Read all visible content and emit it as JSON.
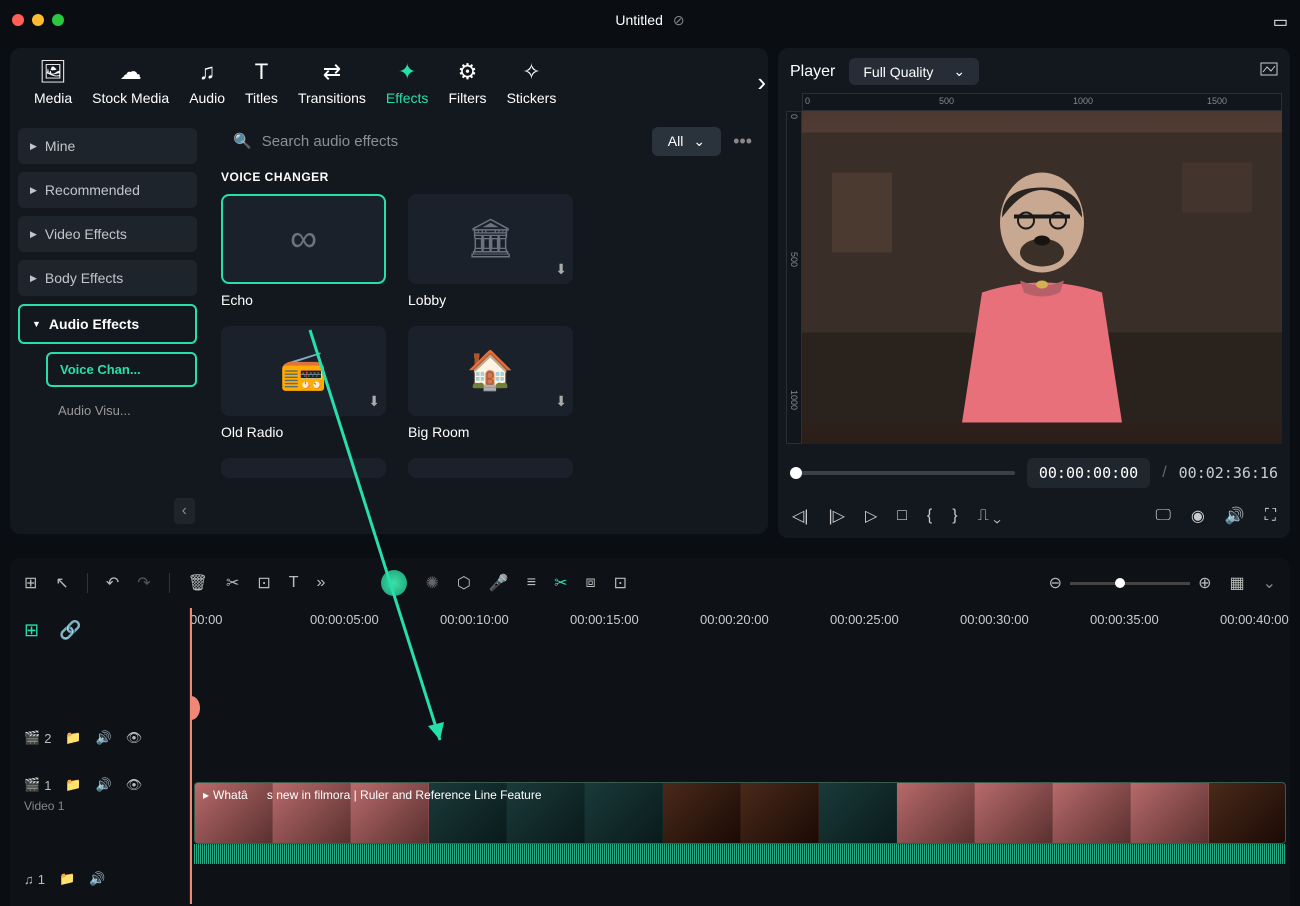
{
  "title": "Untitled",
  "tabs": {
    "media": "Media",
    "stock": "Stock Media",
    "audio": "Audio",
    "titles": "Titles",
    "transitions": "Transitions",
    "effects": "Effects",
    "filters": "Filters",
    "stickers": "Stickers"
  },
  "sidebar": {
    "mine": "Mine",
    "recommended": "Recommended",
    "video": "Video Effects",
    "body": "Body Effects",
    "audio": "Audio Effects",
    "voice": "Voice Chan...",
    "visu": "Audio Visu..."
  },
  "search": {
    "placeholder": "Search audio effects",
    "all": "All"
  },
  "category": "VOICE CHANGER",
  "fx": {
    "echo": "Echo",
    "lobby": "Lobby",
    "radio": "Old Radio",
    "bigroom": "Big Room"
  },
  "player": {
    "label": "Player",
    "quality": "Full Quality",
    "ruler": {
      "r0": "0",
      "r500": "500",
      "r1000": "1000",
      "r1500": "1500"
    },
    "time": "00:00:00:00",
    "slash": "/",
    "duration": "00:02:36:16"
  },
  "timeline": {
    "ticks": {
      "t0": "00:00",
      "t5": "00:00:05:00",
      "t10": "00:00:10:00",
      "t15": "00:00:15:00",
      "t20": "00:00:20:00",
      "t25": "00:00:25:00",
      "t30": "00:00:30:00",
      "t35": "00:00:35:00",
      "t40": "00:00:40:00"
    },
    "track2": "2",
    "track1": "1",
    "video1": "Video 1",
    "audio1": "1",
    "clip": "Whatâs new in filmora | Ruler and Reference Line Feature"
  }
}
